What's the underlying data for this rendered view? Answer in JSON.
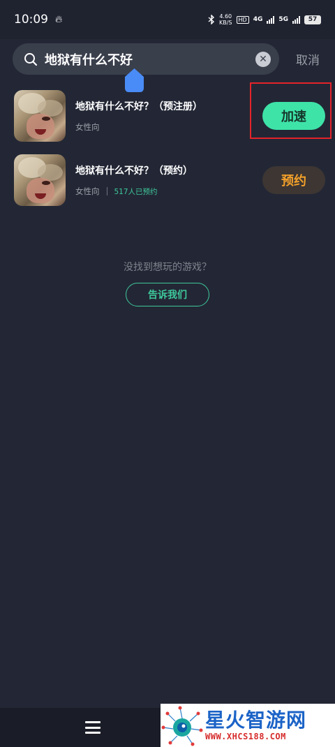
{
  "status_bar": {
    "time": "10:09",
    "network_speed_value": "4.60",
    "network_speed_unit": "KB/S",
    "hd_badge": "HD",
    "net_4g": "4G",
    "net_5g": "5G",
    "battery": "57"
  },
  "search": {
    "query": "地狱有什么不好",
    "cancel_label": "取消"
  },
  "results": [
    {
      "title": "地狱有什么不好？（预注册）",
      "tag": "女性向",
      "reserve_count": "",
      "action_label": "加速"
    },
    {
      "title": "地狱有什么不好？（预约）",
      "tag": "女性向",
      "reserve_count": "517人已预约",
      "action_label": "预约"
    }
  ],
  "empty_prompt": {
    "text": "没找到想玩的游戏？",
    "button_label": "告诉我们"
  },
  "watermark": {
    "title": "星火智游网",
    "url": "WWW.XHCS188.COM"
  },
  "colors": {
    "background": "#232735",
    "accent_green": "#3ee3a8",
    "reserve_orange": "#f4a12a",
    "highlight_red": "#e4232a"
  }
}
